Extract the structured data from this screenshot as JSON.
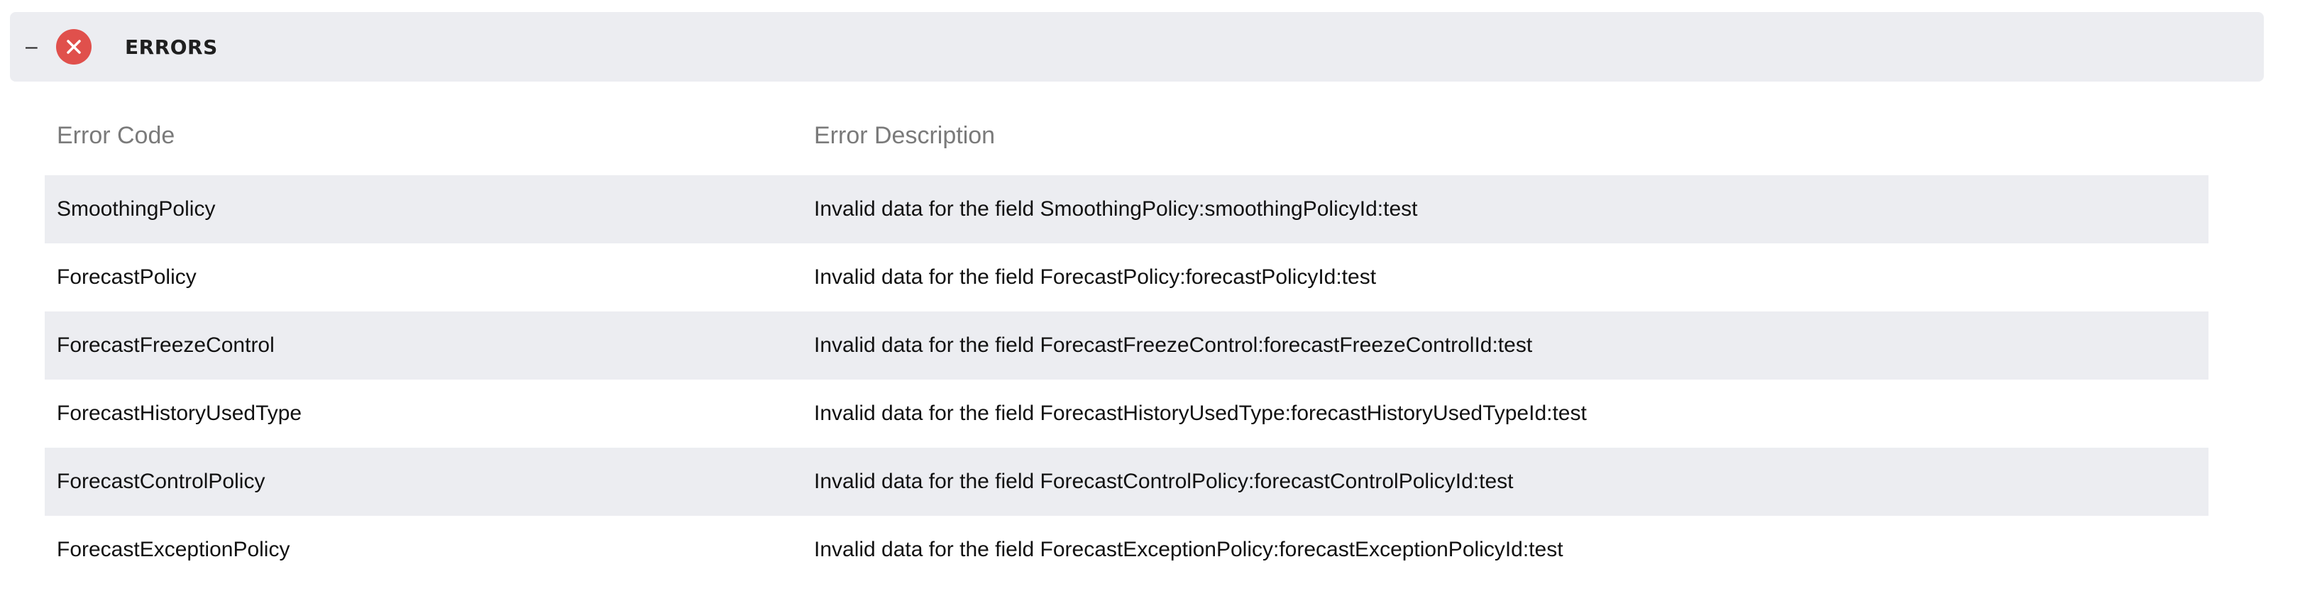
{
  "header": {
    "collapse_symbol": "–",
    "icon": "close-x-circle-icon",
    "title": "ERRORS",
    "accent_color": "#e0504c"
  },
  "table": {
    "columns": [
      "Error Code",
      "Error Description"
    ],
    "rows": [
      {
        "code": "SmoothingPolicy",
        "description": "Invalid data for the field SmoothingPolicy:smoothingPolicyId:test"
      },
      {
        "code": "ForecastPolicy",
        "description": "Invalid data for the field ForecastPolicy:forecastPolicyId:test"
      },
      {
        "code": "ForecastFreezeControl",
        "description": "Invalid data for the field ForecastFreezeControl:forecastFreezeControlId:test"
      },
      {
        "code": "ForecastHistoryUsedType",
        "description": "Invalid data for the field ForecastHistoryUsedType:forecastHistoryUsedTypeId:test"
      },
      {
        "code": "ForecastControlPolicy",
        "description": "Invalid data for the field ForecastControlPolicy:forecastControlPolicyId:test"
      },
      {
        "code": "ForecastExceptionPolicy",
        "description": "Invalid data for the field ForecastExceptionPolicy:forecastExceptionPolicyId:test"
      }
    ]
  }
}
